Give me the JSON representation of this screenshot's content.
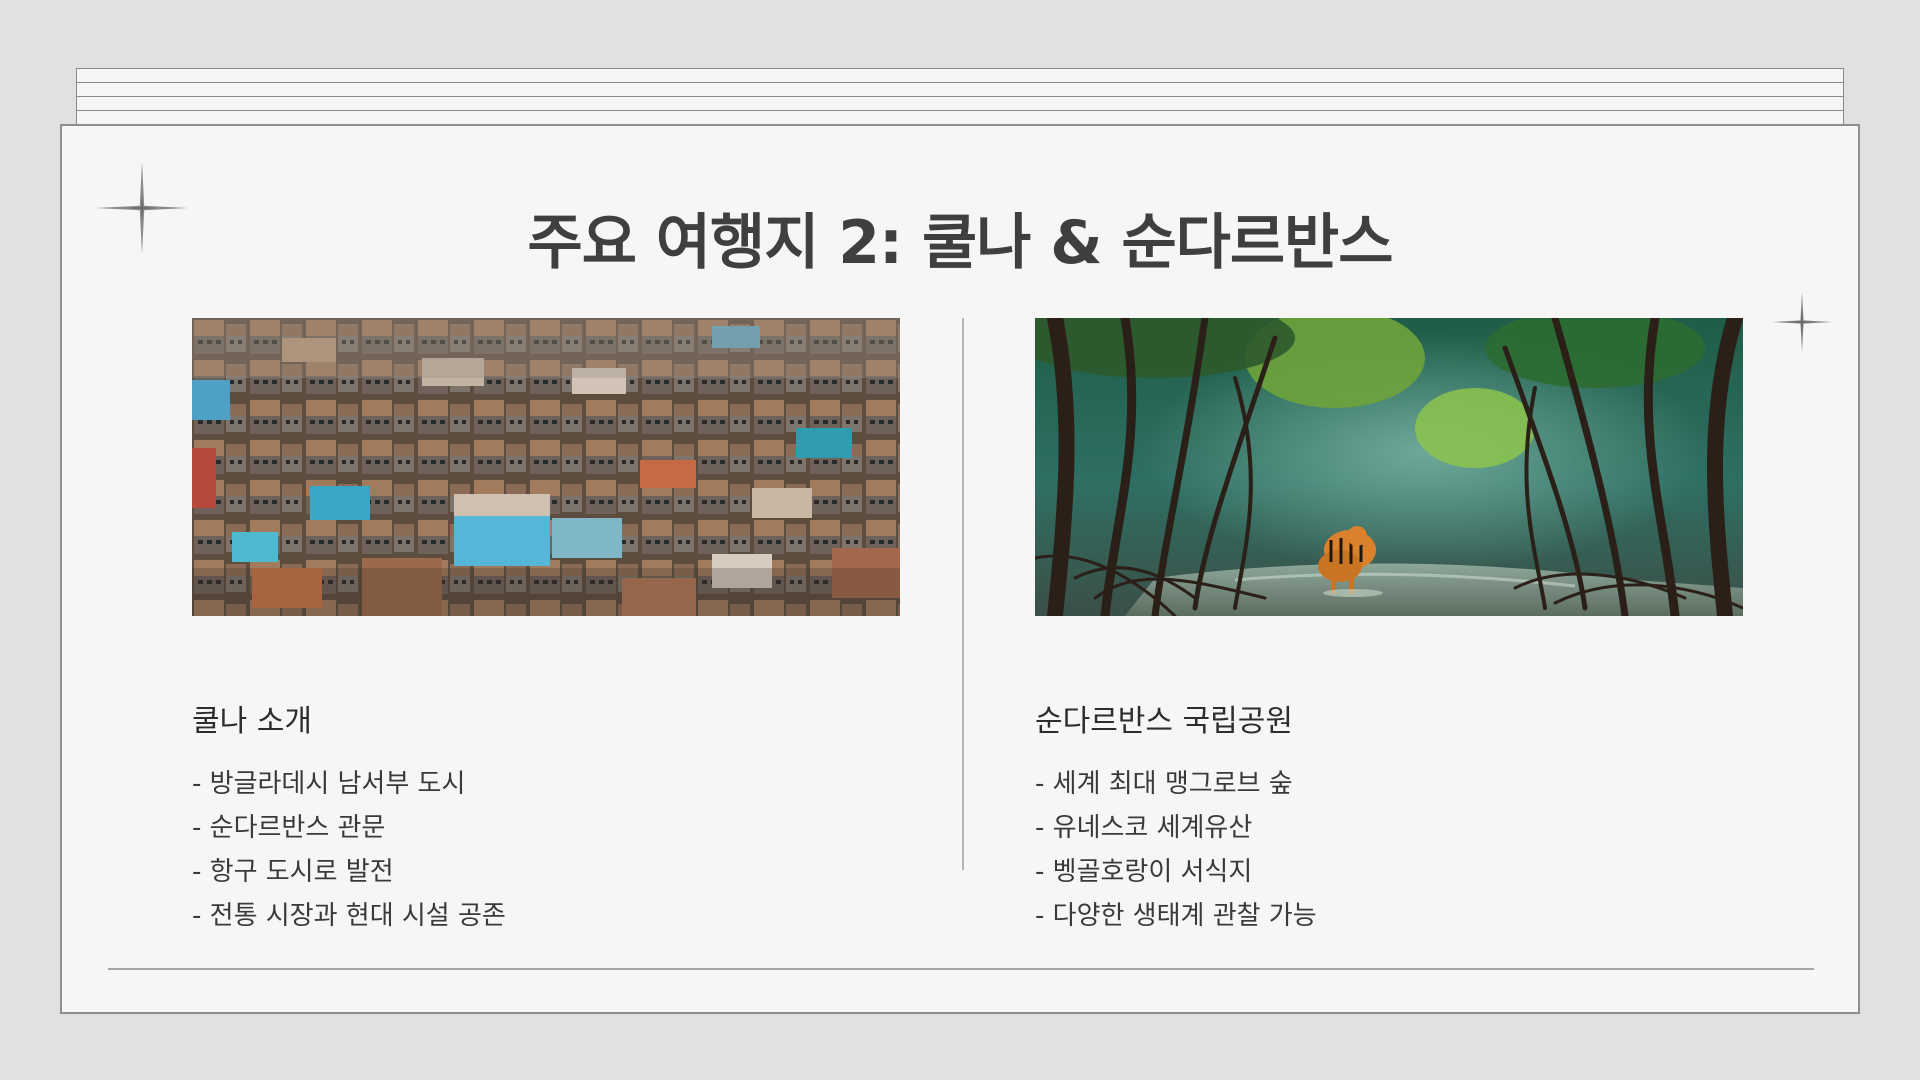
{
  "slide": {
    "title": "주요 여행지 2: 쿨나 & 순다르반스"
  },
  "left": {
    "photo_icon": "aerial-city-photo",
    "heading": "쿨나 소개",
    "bullets": [
      "- 방글라데시 남서부 도시",
      "- 순다르반스 관문",
      "- 항구 도시로 발전",
      "- 전통 시장과 현대 시설 공존"
    ]
  },
  "right": {
    "photo_icon": "mangrove-tiger-photo",
    "heading": "순다르반스 국립공원",
    "bullets": [
      "- 세계 최대 맹그로브 숲",
      "- 유네스코 세계유산",
      "- 벵골호랑이 서식지",
      "- 다양한 생태계 관찰 가능"
    ]
  },
  "colors": {
    "background": "#e0e1e3",
    "card": "#f6f6f6",
    "title": "#3f3f3f",
    "text": "#3a3a3a"
  }
}
